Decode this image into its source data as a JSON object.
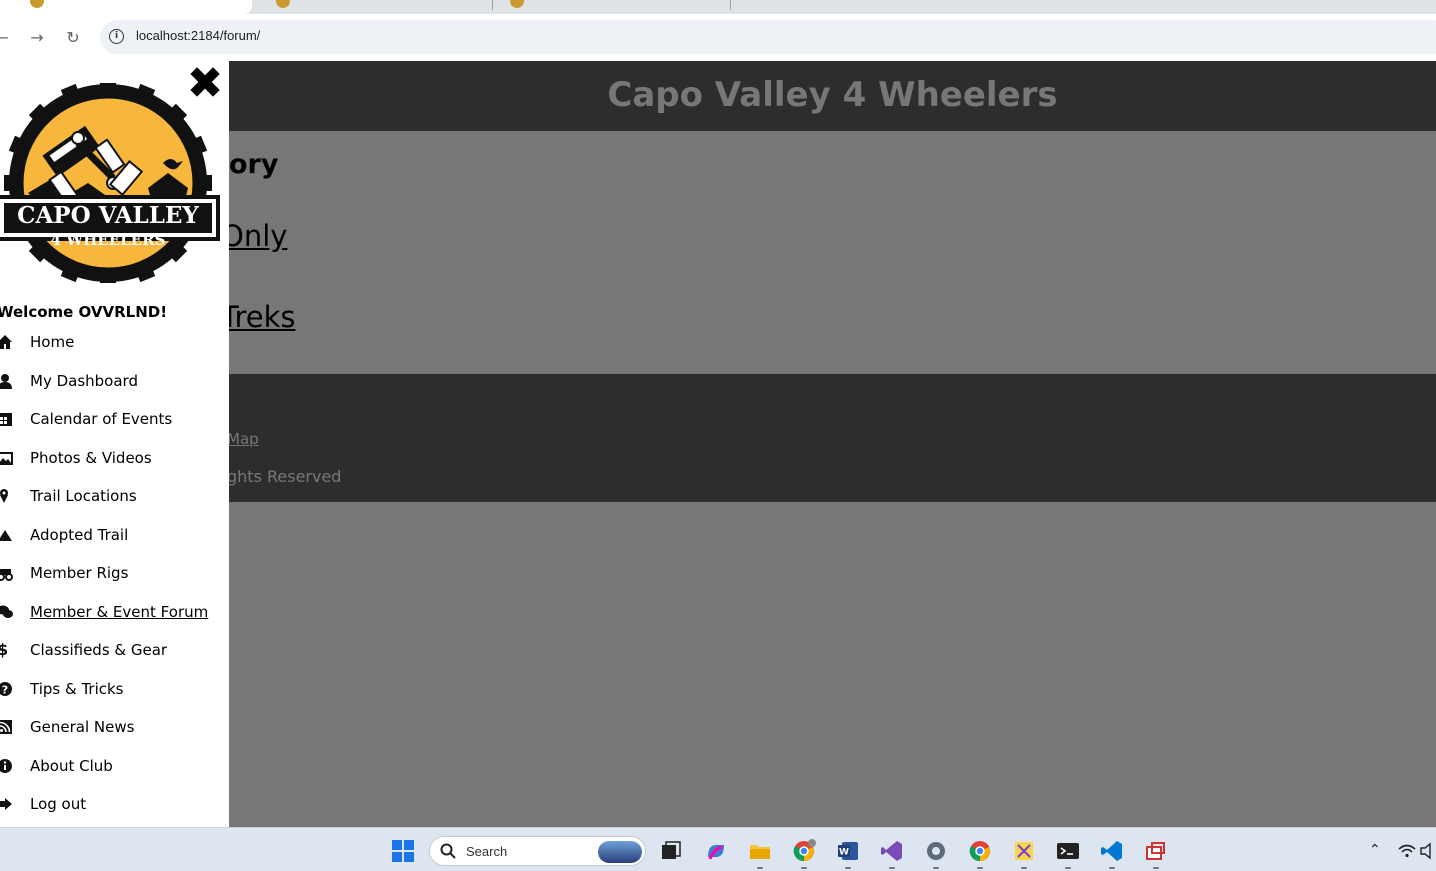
{
  "browser": {
    "url": "localhost:2184/forum/"
  },
  "site": {
    "title": "Capo Valley 4 Wheelers",
    "heading_partial": "ory",
    "categories": [
      {
        "label": "Only"
      },
      {
        "label": "Treks"
      }
    ],
    "footer": {
      "link": "Map",
      "copyright": "ghts Reserved"
    }
  },
  "sidebar": {
    "logo_text_line1": "CAPO VALLEY",
    "logo_text_line2": "4 WHEELERS",
    "welcome": "Welcome OVVRLND!",
    "items": [
      {
        "label": "Home",
        "icon": "home-icon"
      },
      {
        "label": "My Dashboard",
        "icon": "user-icon"
      },
      {
        "label": "Calendar of Events",
        "icon": "calendar-icon"
      },
      {
        "label": "Photos & Videos",
        "icon": "image-icon"
      },
      {
        "label": "Trail Locations",
        "icon": "map-pin-icon"
      },
      {
        "label": "Adopted Trail",
        "icon": "mountain-icon"
      },
      {
        "label": "Member Rigs",
        "icon": "truck-icon"
      },
      {
        "label": "Member & Event Forum",
        "icon": "comments-icon",
        "active": true
      },
      {
        "label": "Classifieds & Gear",
        "icon": "dollar-icon"
      },
      {
        "label": "Tips & Tricks",
        "icon": "question-icon"
      },
      {
        "label": "General News",
        "icon": "rss-icon"
      },
      {
        "label": "About Club",
        "icon": "info-icon"
      },
      {
        "label": "Log out",
        "icon": "logout-icon"
      }
    ]
  },
  "taskbar": {
    "search_label": "Search"
  }
}
